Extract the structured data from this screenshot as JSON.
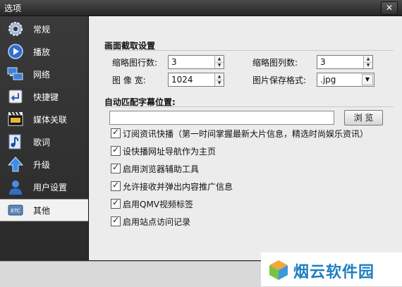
{
  "window": {
    "title": "选项",
    "close": "✕"
  },
  "sidebar": {
    "items": [
      {
        "label": "常规",
        "icon": "gear-icon"
      },
      {
        "label": "播放",
        "icon": "play-icon"
      },
      {
        "label": "网络",
        "icon": "network-icon"
      },
      {
        "label": "快捷键",
        "icon": "shortcut-icon"
      },
      {
        "label": "媒体关联",
        "icon": "film-icon"
      },
      {
        "label": "歌词",
        "icon": "music-note-icon"
      },
      {
        "label": "升级",
        "icon": "upgrade-arrow-icon"
      },
      {
        "label": "用户设置",
        "icon": "user-icon"
      },
      {
        "label": "其他",
        "icon": "etc-icon"
      }
    ],
    "active": "其他"
  },
  "screenshot_settings": {
    "title": "画面截取设置",
    "thumb_rows_label": "缩略图行数:",
    "thumb_rows_value": "3",
    "thumb_cols_label": "缩略图列数:",
    "thumb_cols_value": "3",
    "width_label": "图 像 宽:",
    "width_value": "1024",
    "format_label": "图片保存格式:",
    "format_value": ".jpg"
  },
  "subtitle": {
    "title": "自动匹配字幕位置:",
    "path_value": "",
    "browse_label": "浏 览"
  },
  "options": [
    {
      "label": "订阅资讯快播（第一时间掌握最新大片信息，精选时尚娱乐资讯）",
      "checked": true
    },
    {
      "label": "设快播网址导航作为主页",
      "checked": true
    },
    {
      "label": "启用浏览器辅助工具",
      "checked": true
    },
    {
      "label": "允许接收并弹出内容推广信息",
      "checked": true
    },
    {
      "label": "启用QMV视频标签",
      "checked": true
    },
    {
      "label": "启用站点访问记录",
      "checked": true
    }
  ],
  "watermark": {
    "text": "烟云软件园"
  }
}
